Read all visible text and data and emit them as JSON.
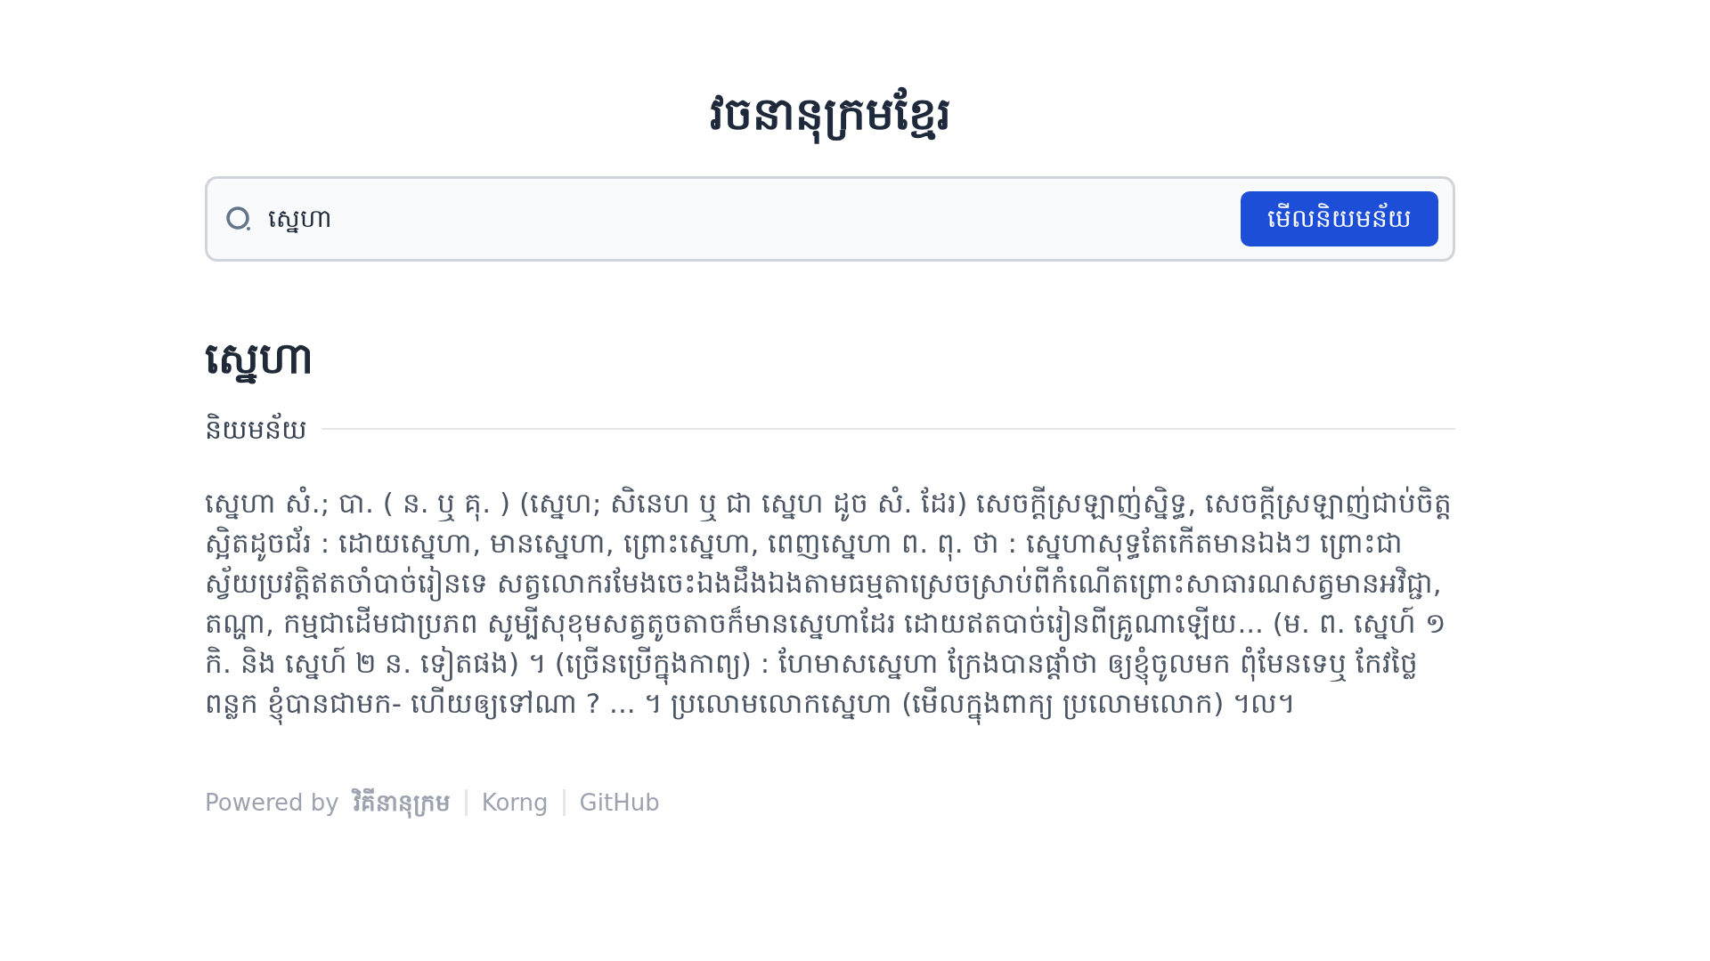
{
  "title": "វចនានុក្រមខ្មែរ",
  "search": {
    "value": "ស្នេហា",
    "button": "មើលនិយមន័យ"
  },
  "entry": {
    "headword": "ស្នេហា",
    "section_label": "និយមន័យ",
    "definition": "ស្នេហា សំ.; បា. ( ន. ឬ គុ. ) (ស្នេហ; សិនេហ ឬ ជា ស្នេហ ដូច សំ. ដែរ) សេចក្ដីស្រឡាញ់ស្និទ្ធ, សេចក្ដីស្រឡាញ់ជាប់ចិត្តស្អិតដូចជ័រ : ដោយស្នេហា, មានស្នេហា, ព្រោះស្នេហា, ពេញស្នេហា ព. ពុ. ថា : ស្នេហាសុទ្ធតែកើតមានឯងៗ ព្រោះជាស្វ័យប្រវត្តិឥតចាំបាច់រៀនទេ សត្វលោករមែងចេះឯងដឹងឯងតាមធម្មតាស្រេចស្រាប់ពីកំណើតព្រោះសាធារណសត្វមានអវិជ្ជា, តណ្ហា, កម្មជាដើមជាប្រភព សូម្បីសុខុមសត្វតូចតាចក៏មានស្នេហាដែរ ដោយឥតបាច់រៀនពីគ្រូណាឡើយ... (ម. ព. ស្នេហ៍ ១ កិ. និង ស្នេហ៍ ២ ន. ទៀតផង) ។ (ច្រើនប្រើក្នុងកាព្យ) : ហែមាសស្នេហា ក្រែងបានផ្ដាំថា ឲ្យខ្ញុំចូលមក ពុំមែនទេឬ កែវថ្លៃពន្លក ខ្ញុំបានជាមក- ហើយឲ្យទៅណា ? ... ។ ប្រលោមលោកស្នេហា (មើលក្នុងពាក្យ ប្រលោមលោក) ។ល។"
  },
  "footer": {
    "powered_by": "Powered by",
    "source": "វិគីនានុក្រម",
    "links": [
      "Korng",
      "GitHub"
    ]
  }
}
